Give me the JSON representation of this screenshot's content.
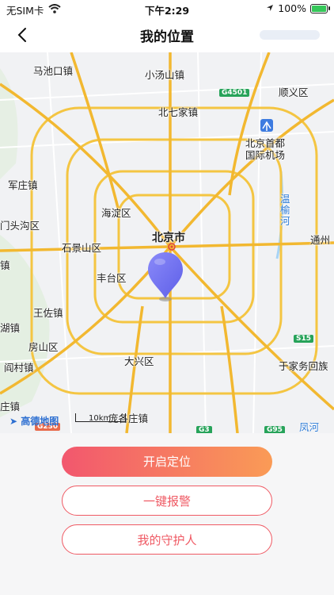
{
  "status_bar": {
    "carrier": "无SIM卡",
    "time": "下午2:29",
    "battery": "100%"
  },
  "nav": {
    "title": "我的位置",
    "back_icon": "chevron-left-icon"
  },
  "map": {
    "labels": [
      {
        "text": "马池口镇"
      },
      {
        "text": "小汤山镇"
      },
      {
        "text": "顺义区"
      },
      {
        "text": "北七家镇"
      },
      {
        "text": "北京首都"
      },
      {
        "text": "国际机场"
      },
      {
        "text": "军庄镇"
      },
      {
        "text": "温"
      },
      {
        "text": "榆"
      },
      {
        "text": "河"
      },
      {
        "text": "海淀区"
      },
      {
        "text": "门头沟区"
      },
      {
        "text": "北京市"
      },
      {
        "text": "石景山区"
      },
      {
        "text": "通州"
      },
      {
        "text": "丰台区"
      },
      {
        "text": "镇"
      },
      {
        "text": "王佐镇"
      },
      {
        "text": "湖镇"
      },
      {
        "text": "房山区"
      },
      {
        "text": "阎村镇"
      },
      {
        "text": "大兴区"
      },
      {
        "text": "于家务回族"
      },
      {
        "text": "庄镇"
      },
      {
        "text": "庞各庄镇"
      },
      {
        "text": "凤河"
      }
    ],
    "road_shields": [
      "G4501",
      "S15",
      "G3",
      "G95",
      "G230"
    ],
    "scale_label": "10km",
    "logo_text": "高德地图"
  },
  "buttons": {
    "start_location": "开启定位",
    "one_key_alarm": "一键报警",
    "my_guardian": "我的守护人"
  }
}
